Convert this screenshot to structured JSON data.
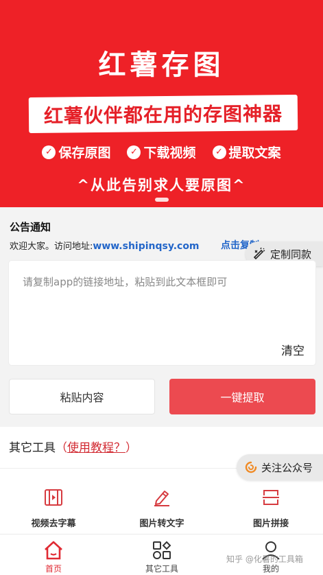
{
  "banner": {
    "title": "红薯存图",
    "slogan": "红薯伙伴都在用的存图神器",
    "features": [
      {
        "icon": "check-circle-icon",
        "label": "保存原图"
      },
      {
        "icon": "check-circle-icon",
        "label": "下载视频"
      },
      {
        "icon": "check-circle-icon",
        "label": "提取文案"
      }
    ],
    "subtitle": "^从此告别求人要原图^",
    "bg_color": "#ee2127"
  },
  "notice": {
    "title": "公告通知",
    "text": "欢迎大家。访问地址:",
    "url": "www.shipinqsy.com",
    "copy_label": "点击复制"
  },
  "custom_button": {
    "icon": "wand-icon",
    "label": "定制同款"
  },
  "link_input": {
    "placeholder": "请复制app的链接地址，粘贴到此文本框即可",
    "value": "",
    "clear_label": "清空"
  },
  "actions": {
    "paste_label": "粘贴内容",
    "extract_label": "一键提取",
    "accent_color": "#ec4a50"
  },
  "tools": {
    "heading": "其它工具",
    "paren_open": "（",
    "tutorial_label": "使用教程？",
    "paren_close": "）",
    "items": [
      {
        "icon": "video-frame-icon",
        "label": "视频去字幕"
      },
      {
        "icon": "pencil-icon",
        "label": "图片转文字"
      },
      {
        "icon": "image-stitch-icon",
        "label": "图片拼接"
      }
    ]
  },
  "follow_button": {
    "icon": "spinner-icon",
    "label": "关注公众号"
  },
  "bottom_nav": {
    "items": [
      {
        "icon": "home-icon",
        "label": "首页",
        "active": true
      },
      {
        "icon": "tools-icon",
        "label": "其它工具",
        "active": false
      },
      {
        "icon": "user-icon",
        "label": "我的",
        "active": false
      }
    ]
  },
  "watermark": "知乎 @化暑的工具箱"
}
